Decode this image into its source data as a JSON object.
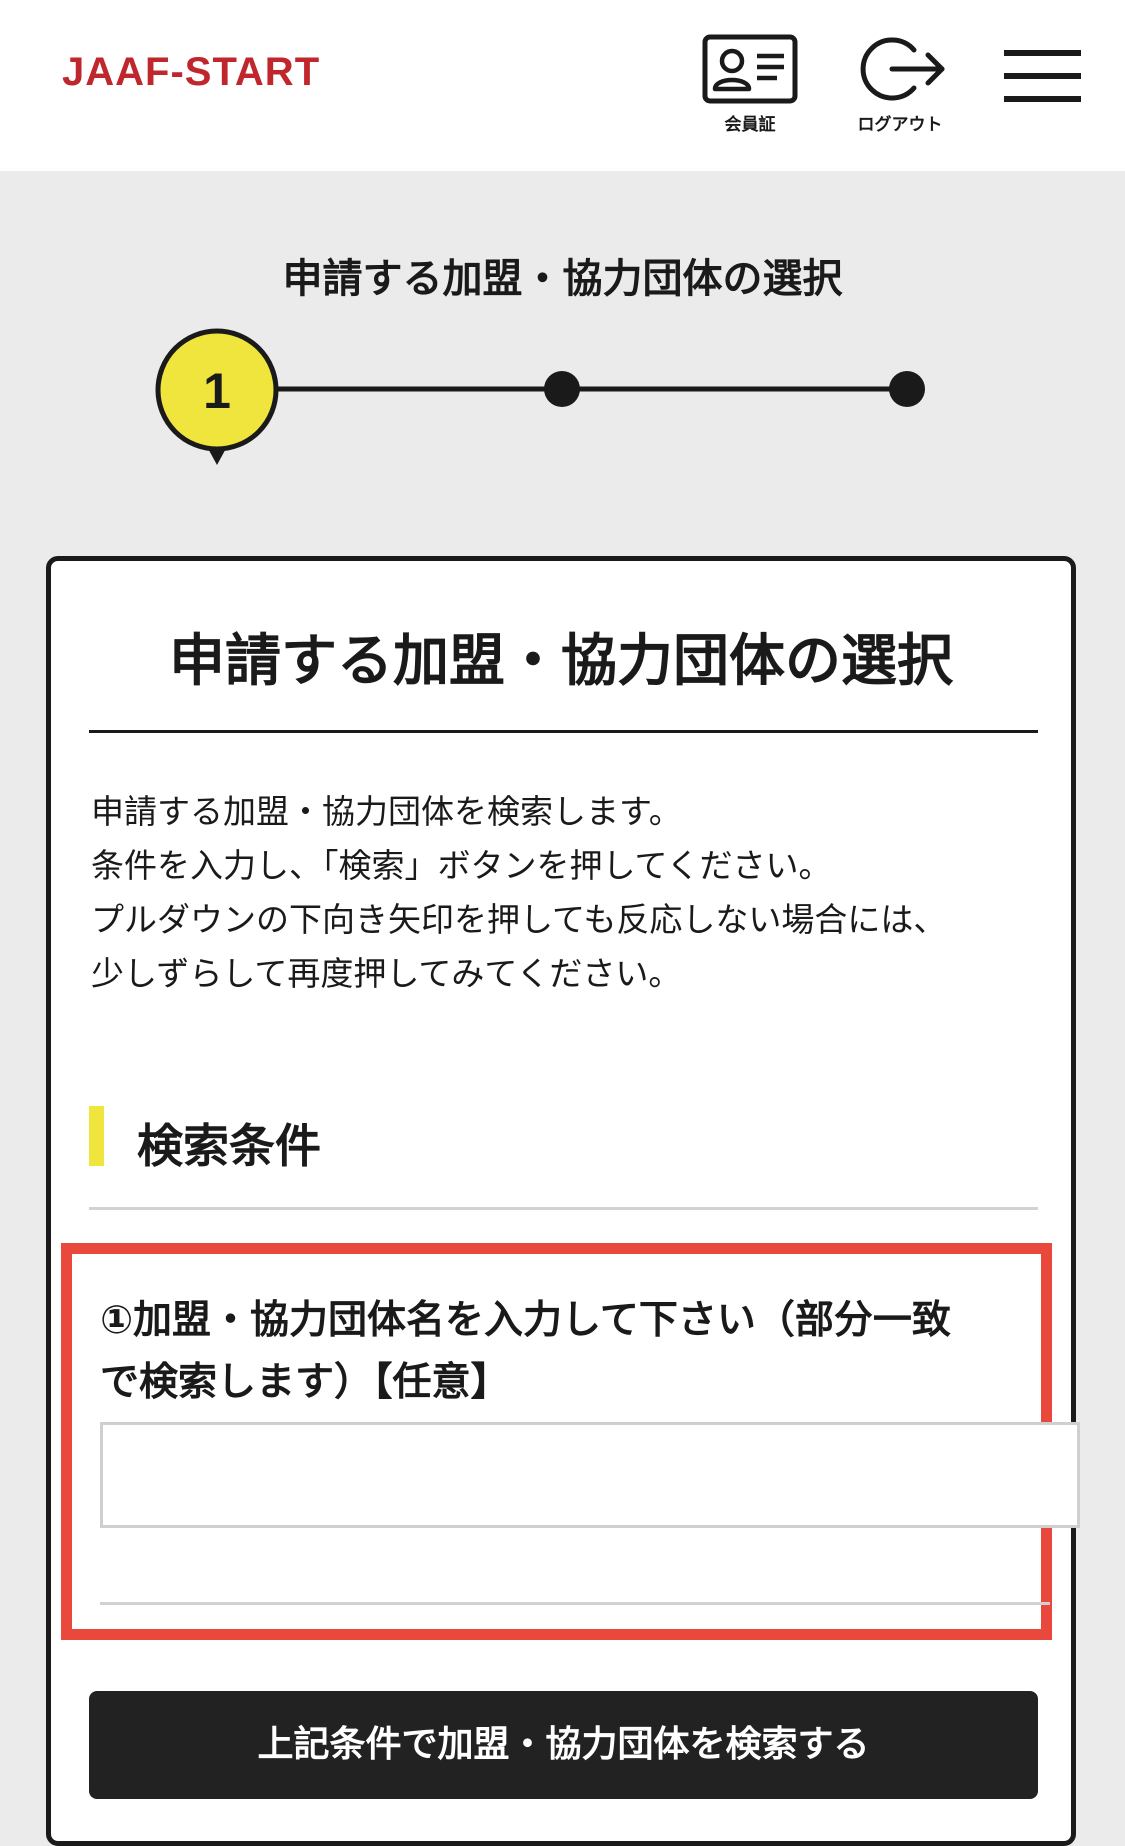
{
  "header": {
    "logo": "JAAF-START",
    "member_card_label": "会員証",
    "logout_label": "ログアウト",
    "menu_icon": "hamburger-menu-icon"
  },
  "step": {
    "title": "申請する加盟・協力団体の選択",
    "current": "1",
    "total": 3,
    "active_color": "#f0e53c"
  },
  "card": {
    "title": "申請する加盟・協力団体の選択",
    "description": [
      "申請する加盟・協力団体を検索します。",
      "条件を入力し、「検索」ボタンを押してください。",
      "プルダウンの下向き矢印を押しても反応しない場合には、",
      "少しずらして再度押してみてください。"
    ],
    "section_title": "検索条件",
    "field": {
      "label_line1": "①加盟・協力団体名を入力して下さい（部分一致",
      "label_line2": "で検索します）【任意】",
      "value": "",
      "placeholder": ""
    },
    "search_button_label": "上記条件で加盟・協力団体を検索する"
  },
  "colors": {
    "brand": "#c0272d",
    "accent": "#f0e53c",
    "highlight": "#e8493c",
    "button": "#222222"
  }
}
